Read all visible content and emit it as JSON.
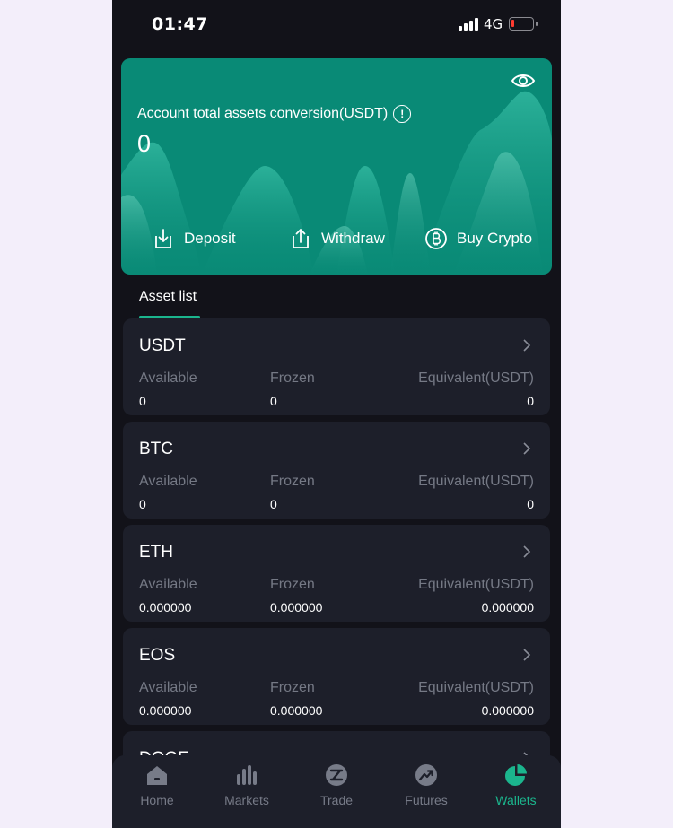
{
  "status_bar": {
    "time": "01:47",
    "network": "4G",
    "battery_level": 0.15
  },
  "hero": {
    "label": "Account total assets conversion(USDT)",
    "info_glyph": "!",
    "value": "0",
    "actions": [
      {
        "label": "Deposit",
        "icon": "deposit-icon"
      },
      {
        "label": "Withdraw",
        "icon": "withdraw-icon"
      },
      {
        "label": "Buy Crypto",
        "icon": "bitcoin-icon"
      }
    ]
  },
  "asset_tab": {
    "label": "Asset list"
  },
  "columns": {
    "available": "Available",
    "frozen": "Frozen",
    "equivalent": "Equivalent(USDT)"
  },
  "assets": [
    {
      "name": "USDT",
      "available": "0",
      "frozen": "0",
      "equivalent": "0"
    },
    {
      "name": "BTC",
      "available": "0",
      "frozen": "0",
      "equivalent": "0"
    },
    {
      "name": "ETH",
      "available": "0.000000",
      "frozen": "0.000000",
      "equivalent": "0.000000"
    },
    {
      "name": "EOS",
      "available": "0.000000",
      "frozen": "0.000000",
      "equivalent": "0.000000"
    },
    {
      "name": "DOGE",
      "available": "",
      "frozen": "",
      "equivalent": ""
    }
  ],
  "nav": [
    {
      "label": "Home",
      "icon": "home-icon"
    },
    {
      "label": "Markets",
      "icon": "markets-icon"
    },
    {
      "label": "Trade",
      "icon": "trade-icon"
    },
    {
      "label": "Futures",
      "icon": "futures-icon"
    },
    {
      "label": "Wallets",
      "icon": "wallet-icon",
      "active": true
    }
  ],
  "colors": {
    "accent": "#1bb58d",
    "card": "#098a76",
    "background": "#121219",
    "panel": "#1d1f2a"
  }
}
